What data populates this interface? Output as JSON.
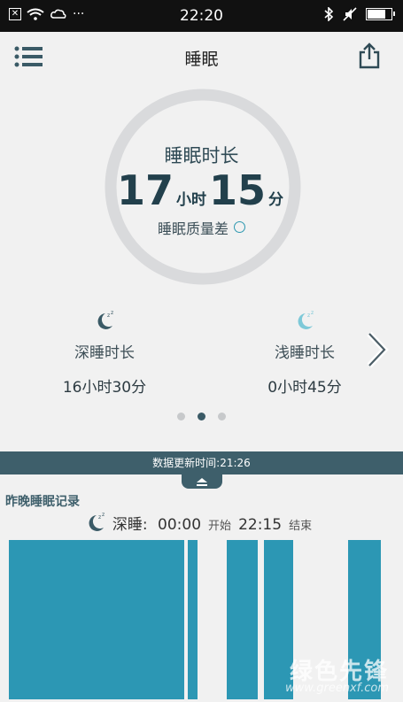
{
  "status_bar": {
    "time": "22:20",
    "battery_level": 0.8,
    "mute_symbol": "✕",
    "dots": "···"
  },
  "header": {
    "title": "睡眠"
  },
  "summary": {
    "label": "睡眠时长",
    "hours": "17",
    "hours_unit": "小时",
    "minutes": "15",
    "minutes_unit": "分",
    "quality": "睡眠质量差"
  },
  "stats": [
    {
      "label": "深睡时长",
      "value": "16小时30分"
    },
    {
      "label": "浅睡时长",
      "value": "0小时45分"
    }
  ],
  "pager": {
    "count": 3,
    "active": 1
  },
  "update_bar": {
    "text": "数据更新时间:21:26"
  },
  "record": {
    "title": "昨晚睡眠记录",
    "sleep_type": "深睡:",
    "start_time": "00:00",
    "start_label": "开始",
    "end_time": "22:15",
    "end_label": "结束"
  },
  "colors": {
    "accent": "#2c97b4",
    "dark_bar": "#3e5f6b",
    "light_sleep": "#7ec9d8"
  },
  "chart_data": {
    "type": "bar",
    "segments": [
      {
        "start": 0.0,
        "end": 0.45
      },
      {
        "start": 0.46,
        "end": 0.485
      },
      {
        "start": 0.56,
        "end": 0.64
      },
      {
        "start": 0.655,
        "end": 0.73
      },
      {
        "start": 0.87,
        "end": 0.955
      }
    ]
  },
  "watermark": {
    "text": "绿色先锋",
    "url": "www.greenxf.com"
  }
}
